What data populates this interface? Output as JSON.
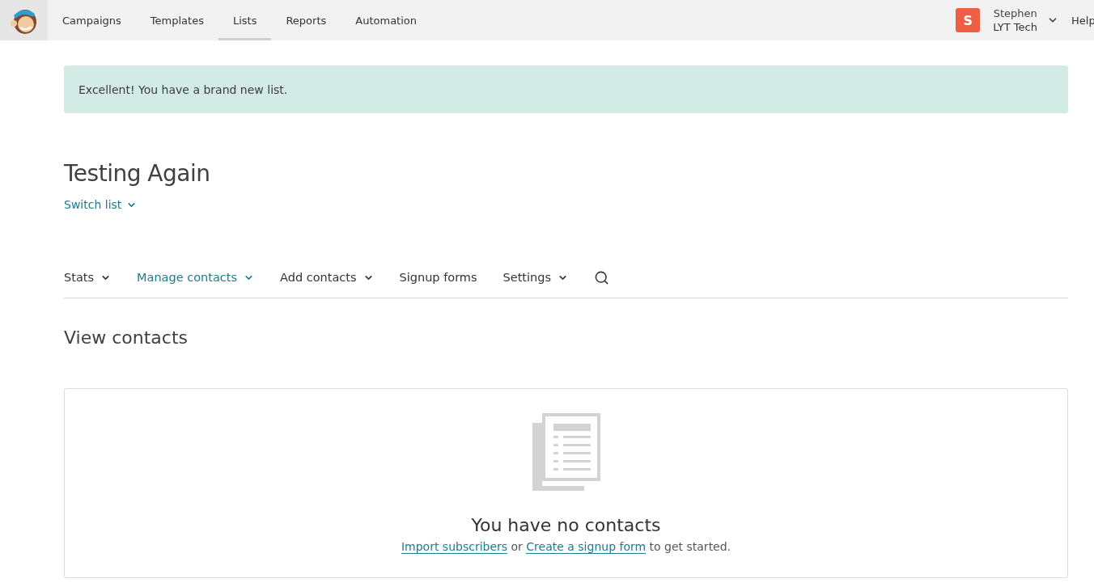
{
  "nav": {
    "items": [
      {
        "label": "Campaigns",
        "selected": false
      },
      {
        "label": "Templates",
        "selected": false
      },
      {
        "label": "Lists",
        "selected": true
      },
      {
        "label": "Reports",
        "selected": false
      },
      {
        "label": "Automation",
        "selected": false
      }
    ],
    "account": {
      "initial": "S",
      "name": "Stephen",
      "company": "LYT Tech"
    },
    "help": "Help"
  },
  "alert": "Excellent! You have a brand new list.",
  "list_title": "Testing Again",
  "switch_list": "Switch list",
  "tabs": [
    {
      "label": "Stats",
      "selected": false,
      "kind": "menu"
    },
    {
      "label": "Manage contacts",
      "selected": true,
      "kind": "menu"
    },
    {
      "label": "Add contacts",
      "selected": false,
      "kind": "menu"
    },
    {
      "label": "Signup forms",
      "selected": false,
      "kind": "link"
    },
    {
      "label": "Settings",
      "selected": false,
      "kind": "menu"
    }
  ],
  "section_title": "View contacts",
  "empty_state": {
    "title": "You have no contacts",
    "link_1": "Import subscribers",
    "joiner": "or",
    "link_2": "Create a signup form",
    "suffix": "to get started."
  }
}
